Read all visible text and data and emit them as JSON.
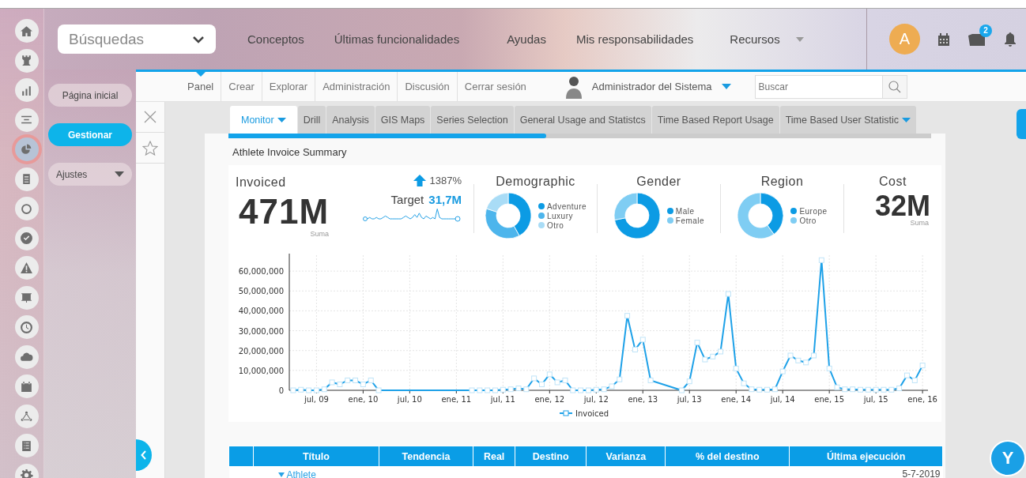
{
  "rail_items": [
    {
      "selected": false
    },
    {
      "selected": false
    },
    {
      "selected": false
    },
    {
      "selected": false
    },
    {
      "selected": true
    },
    {
      "selected": false
    },
    {
      "selected": false
    },
    {
      "selected": false
    },
    {
      "selected": false
    },
    {
      "selected": false
    },
    {
      "selected": false
    },
    {
      "selected": false
    },
    {
      "selected": false
    },
    {
      "selected": false
    },
    {
      "selected": false
    },
    {
      "selected": false
    }
  ],
  "search_dropdown": {
    "value": "Búsquedas"
  },
  "top_nav": [
    {
      "label": "Conceptos",
      "has_menu": false
    },
    {
      "label": "Últimas funcionalidades",
      "has_menu": false
    },
    {
      "label": "Ayudas",
      "has_menu": false
    },
    {
      "label": "Mis responsabilidades",
      "has_menu": false
    },
    {
      "label": "Recursos",
      "has_menu": true
    }
  ],
  "avatar": {
    "initial": "A"
  },
  "notifications_badge": "2",
  "sidebar": [
    {
      "label": "Página inicial",
      "selected": false,
      "has_menu": false
    },
    {
      "label": "Gestionar",
      "selected": true,
      "has_menu": false
    },
    {
      "label": "Ajustes",
      "selected": false,
      "has_menu": true
    }
  ],
  "menu_bar": [
    {
      "label": "Panel",
      "selected": true
    },
    {
      "label": "Crear",
      "selected": false
    },
    {
      "label": "Explorar",
      "selected": false
    },
    {
      "label": "Administración",
      "selected": false
    },
    {
      "label": "Discusión",
      "selected": false
    },
    {
      "label": "Cerrar sesión",
      "selected": false
    }
  ],
  "user": {
    "name": "Administrador del Sistema"
  },
  "search": {
    "placeholder": "Buscar"
  },
  "tabs": [
    {
      "label": "Monitor",
      "selected": true,
      "has_menu": true
    },
    {
      "label": "Drill",
      "selected": false,
      "has_menu": false
    },
    {
      "label": "Analysis",
      "selected": false,
      "has_menu": false
    },
    {
      "label": "GIS Maps",
      "selected": false,
      "has_menu": false
    },
    {
      "label": "Series Selection",
      "selected": false,
      "has_menu": false
    },
    {
      "label": "General Usage and Statistcs",
      "selected": false,
      "has_menu": false
    },
    {
      "label": "Time Based Report Usage",
      "selected": false,
      "has_menu": false
    },
    {
      "label": "Time Based User Statistic",
      "selected": false,
      "has_menu": true
    }
  ],
  "report": {
    "title": "Athlete Invoice Summary",
    "summary": {
      "title": "Invoiced",
      "change": "1387%",
      "value": "471M",
      "aggregate": "Suma",
      "target_label": "Target",
      "target_value": "31,7M"
    },
    "donuts": [
      {
        "title": "Demographic",
        "legend": [
          {
            "label": "Adventure",
            "color": "#0c9be4"
          },
          {
            "label": "Luxury",
            "color": "#4db5ec"
          },
          {
            "label": "Otro",
            "color": "#a9dcf6"
          }
        ]
      },
      {
        "title": "Gender",
        "legend": [
          {
            "label": "Male",
            "color": "#0c9be4"
          },
          {
            "label": "Female",
            "color": "#7fcdf3"
          }
        ]
      },
      {
        "title": "Region",
        "legend": [
          {
            "label": "Europe",
            "color": "#0c9be4"
          },
          {
            "label": "Otro",
            "color": "#7fcdf3"
          }
        ]
      }
    ],
    "cost": {
      "title": "Cost",
      "value": "32M",
      "aggregate": "Suma"
    },
    "chart_data": {
      "type": "line",
      "grid": true,
      "x": [
        9.25,
        9.3333,
        9.4167,
        9.5,
        9.5833,
        9.6667,
        9.75,
        9.8333,
        9.9167,
        10,
        10.0833,
        10.1667,
        11.1667,
        11.25,
        11.3333,
        11.4167,
        11.5,
        11.5833,
        11.6667,
        11.75,
        11.8333,
        11.9167,
        12,
        12.0833,
        12.1667,
        12.25,
        12.3333,
        12.4167,
        12.5,
        12.5833,
        12.6667,
        12.75,
        12.8333,
        12.9167,
        13,
        13.0833,
        13.4167,
        13.5,
        13.5833,
        13.6667,
        13.75,
        13.8333,
        13.9167,
        14,
        14.0833,
        14.1667,
        14.25,
        14.3333,
        14.4167,
        14.5,
        14.5833,
        14.6667,
        14.75,
        14.8333,
        14.9167,
        15,
        15.0833,
        15.1667,
        15.25,
        15.3333,
        15.4167,
        15.5,
        15.5833,
        15.6667,
        15.75,
        15.8333,
        15.9167,
        16
      ],
      "series": [
        {
          "name": "Invoiced",
          "color": "#1ea1e8",
          "marker": "square",
          "values": [
            0,
            300000,
            0,
            0,
            500000,
            4000000,
            3000000,
            5000000,
            5000000,
            3000000,
            5000000,
            0,
            0,
            0,
            0,
            0,
            300000,
            500000,
            1000000,
            500000,
            6000000,
            3000000,
            8000000,
            4000000,
            5000000,
            0,
            0,
            0,
            300000,
            500000,
            2000000,
            5500000,
            37500000,
            20500000,
            25500000,
            5000000,
            0,
            4500000,
            24000000,
            15500000,
            17000000,
            19500000,
            48500000,
            11000000,
            3500000,
            500000,
            300000,
            300000,
            500000,
            9500000,
            17500000,
            15000000,
            14000000,
            17500000,
            65500000,
            11000000,
            1500000,
            500000,
            500000,
            300000,
            300000,
            300000,
            300000,
            300000,
            1000000,
            7500000,
            5000000,
            12500000
          ]
        }
      ],
      "xlim": [
        9.2083,
        16.0583
      ],
      "ylim": [
        0,
        68000000
      ],
      "xticks": [
        {
          "value": 9.5,
          "label": "jul, 09"
        },
        {
          "value": 10,
          "label": "ene, 10"
        },
        {
          "value": 10.5,
          "label": "jul, 10"
        },
        {
          "value": 11,
          "label": "ene, 11"
        },
        {
          "value": 11.5,
          "label": "jul, 11"
        },
        {
          "value": 12,
          "label": "ene, 12"
        },
        {
          "value": 12.5,
          "label": "jul, 12"
        },
        {
          "value": 13,
          "label": "ene, 13"
        },
        {
          "value": 13.5,
          "label": "jul, 13"
        },
        {
          "value": 14,
          "label": "ene, 14"
        },
        {
          "value": 14.5,
          "label": "jul, 14"
        },
        {
          "value": 15,
          "label": "ene, 15"
        },
        {
          "value": 15.5,
          "label": "jul, 15"
        },
        {
          "value": 16,
          "label": "ene, 16"
        }
      ],
      "yticks": [
        {
          "value": 0,
          "label": "0"
        },
        {
          "value": 10000000,
          "label": "10,000,000"
        },
        {
          "value": 20000000,
          "label": "20,000,000"
        },
        {
          "value": 30000000,
          "label": "30,000,000"
        },
        {
          "value": 40000000,
          "label": "40,000,000"
        },
        {
          "value": 50000000,
          "label": "50,000,000"
        },
        {
          "value": 60000000,
          "label": "60,000,000"
        }
      ]
    },
    "table": {
      "columns": [
        "Título",
        "Tendencia",
        "Real",
        "Destino",
        "Varianza",
        "% del destino",
        "Última ejecución"
      ],
      "rows": [
        {
          "title": "Athlete",
          "expanded": true,
          "last_run": "5-7-2019"
        }
      ]
    }
  },
  "help_button": {
    "logo_text": "Y"
  }
}
